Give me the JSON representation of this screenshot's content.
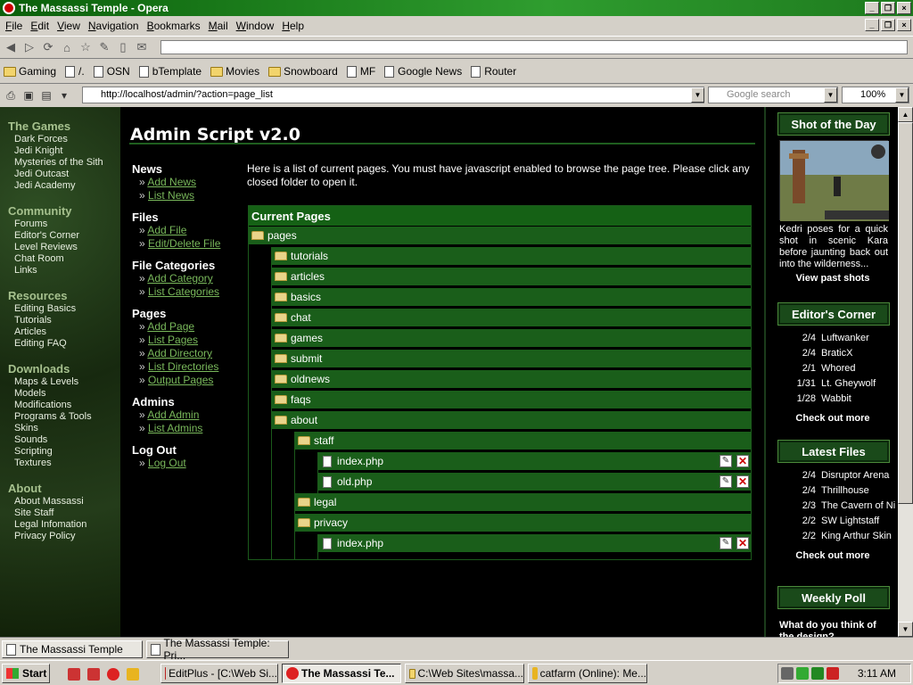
{
  "window": {
    "title": "The Massassi Temple - Opera"
  },
  "menubar": [
    "File",
    "Edit",
    "View",
    "Navigation",
    "Bookmarks",
    "Mail",
    "Window",
    "Help"
  ],
  "bookmarks": [
    "Gaming",
    "/.",
    "OSN",
    "bTemplate",
    "Movies",
    "Snowboard",
    "MF",
    "Google News",
    "Router"
  ],
  "address": {
    "url": "http://localhost/admin/?action=page_list",
    "search_placeholder": "Google search",
    "zoom": "100%"
  },
  "leftnav": [
    {
      "head": "The Games",
      "items": [
        "Dark Forces",
        "Jedi Knight",
        "Mysteries of the Sith",
        "Jedi Outcast",
        "Jedi Academy"
      ]
    },
    {
      "head": "Community",
      "items": [
        "Forums",
        "Editor's Corner",
        "Level Reviews",
        "Chat Room",
        "Links"
      ]
    },
    {
      "head": "Resources",
      "items": [
        "Editing Basics",
        "Tutorials",
        "Articles",
        "Editing FAQ"
      ]
    },
    {
      "head": "Downloads",
      "items": [
        "Maps & Levels",
        "Models",
        "Modifications",
        "Programs & Tools",
        "Skins",
        "Sounds",
        "Scripting",
        "Textures"
      ]
    },
    {
      "head": "About",
      "items": [
        "About Massassi",
        "Site Staff",
        "Legal Infomation",
        "Privacy Policy"
      ]
    }
  ],
  "content": {
    "title": "Admin Script v2.0",
    "intro": "Here is a list of current pages. You must have javascript enabled to browse the page tree. Please click any closed folder to open it.",
    "menu": [
      {
        "head": "News",
        "links": [
          "Add News",
          "List News"
        ]
      },
      {
        "head": "Files",
        "links": [
          "Add File",
          "Edit/Delete File"
        ]
      },
      {
        "head": "File Categories",
        "links": [
          "Add Category",
          "List Categories"
        ]
      },
      {
        "head": "Pages",
        "links": [
          "Add Page",
          "List Pages",
          "Add Directory",
          "List Directories",
          "Output Pages"
        ]
      },
      {
        "head": "Admins",
        "links": [
          "Add Admin",
          "List Admins"
        ]
      },
      {
        "head": "Log Out",
        "links": [
          "Log Out"
        ]
      }
    ],
    "tree_title": "Current Pages",
    "tree": [
      {
        "name": "pages",
        "type": "folder",
        "depth": 0
      },
      {
        "name": "tutorials",
        "type": "folder",
        "depth": 1
      },
      {
        "name": "articles",
        "type": "folder",
        "depth": 1
      },
      {
        "name": "basics",
        "type": "folder",
        "depth": 1
      },
      {
        "name": "chat",
        "type": "folder",
        "depth": 1
      },
      {
        "name": "games",
        "type": "folder",
        "depth": 1
      },
      {
        "name": "submit",
        "type": "folder",
        "depth": 1
      },
      {
        "name": "oldnews",
        "type": "folder",
        "depth": 1
      },
      {
        "name": "faqs",
        "type": "folder",
        "depth": 1
      },
      {
        "name": "about",
        "type": "folder",
        "depth": 1
      },
      {
        "name": "staff",
        "type": "folder",
        "depth": 2
      },
      {
        "name": "index.php",
        "type": "file",
        "depth": 3
      },
      {
        "name": "old.php",
        "type": "file",
        "depth": 3
      },
      {
        "name": "legal",
        "type": "folder",
        "depth": 2
      },
      {
        "name": "privacy",
        "type": "folder",
        "depth": 2
      },
      {
        "name": "index.php",
        "type": "file",
        "depth": 3
      }
    ]
  },
  "right": {
    "shot_title": "Shot of the Day",
    "shot_caption": "Kedri poses for a quick shot in scenic Kara before jaunting back out into the wilderness...",
    "shot_link": "View past shots",
    "editors_title": "Editor's Corner",
    "editors": [
      {
        "date": "2/4",
        "name": "Luftwanker"
      },
      {
        "date": "2/4",
        "name": "BraticX"
      },
      {
        "date": "2/1",
        "name": "Whored"
      },
      {
        "date": "1/31",
        "name": "Lt. Gheywolf"
      },
      {
        "date": "1/28",
        "name": "Wabbit"
      }
    ],
    "editors_more": "Check out more",
    "files_title": "Latest Files",
    "files": [
      {
        "date": "2/4",
        "name": "Disruptor Arena"
      },
      {
        "date": "2/4",
        "name": "Thrillhouse"
      },
      {
        "date": "2/3",
        "name": "The Cavern of Ni"
      },
      {
        "date": "2/2",
        "name": "SW Lightstaff"
      },
      {
        "date": "2/2",
        "name": "King Arthur Skin"
      }
    ],
    "files_more": "Check out more",
    "poll_title": "Weekly Poll",
    "poll_question": "What do you think of the design?"
  },
  "tabs": [
    "The Massassi Temple",
    "The Massassi Temple: Pri..."
  ],
  "taskbar": {
    "start": "Start",
    "tasks": [
      "EditPlus - [C:\\Web Si...",
      "The Massassi Te...",
      "C:\\Web Sites\\massa...",
      "catfarm (Online): Me..."
    ],
    "clock": "3:11 AM"
  }
}
